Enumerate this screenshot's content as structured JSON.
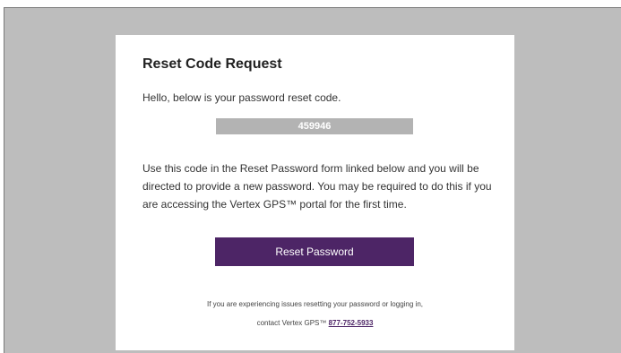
{
  "email": {
    "title": "Reset Code Request",
    "greeting": "Hello, below is your password reset code.",
    "reset_code": "459946",
    "instructions": "Use this code in the Reset Password form linked below and you will be directed to provide a new password. You may be required to do this if you are accessing the Vertex GPS™ portal for the first time.",
    "button_label": "Reset Password",
    "footer_line1": "If you are experiencing issues resetting your password or logging in,",
    "footer_line2_prefix": "contact Vertex GPS™",
    "support_phone": "877-752-5933"
  },
  "colors": {
    "background": "#bdbdbd",
    "card": "#ffffff",
    "code_box": "#b3b3b3",
    "button": "#4d2566"
  }
}
